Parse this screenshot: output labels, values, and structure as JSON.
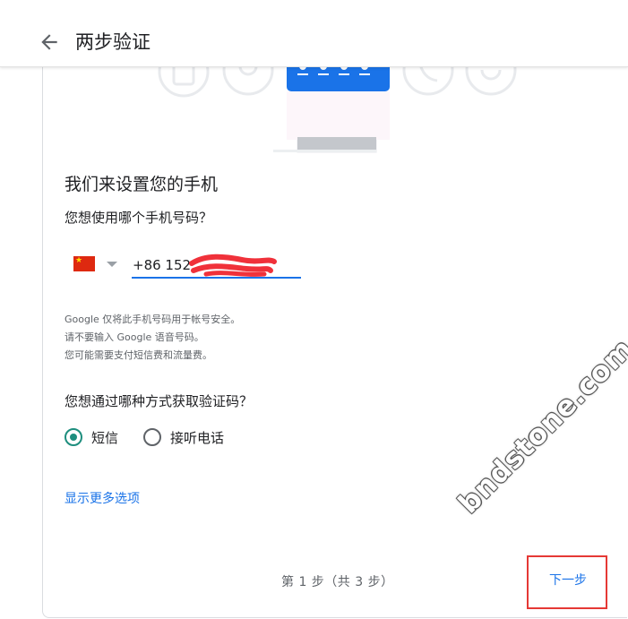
{
  "header": {
    "title": "两步验证",
    "back_icon": "arrow-back-icon"
  },
  "main": {
    "heading": "我们来设置您的手机",
    "phone_question": "您想使用哪个手机号码？",
    "country_flag": "china-flag-icon",
    "phone_value": "+86 152",
    "notes": [
      "Google 仅将此手机号码用于帐号安全。",
      "请不要输入 Google 语音号码。",
      "您可能需要支付短信费和流量费。"
    ],
    "method_question": "您想通过哪种方式获取验证码？",
    "options": [
      {
        "label": "短信",
        "checked": true
      },
      {
        "label": "接听电话",
        "checked": false
      }
    ],
    "more_options": "显示更多选项",
    "step_text": "第 1 步（共 3 步）",
    "next_label": "下一步"
  },
  "colors": {
    "accent": "#1a73e8",
    "radio_checked": "#1e8e7e",
    "highlight": "#e53935",
    "redaction": "#f0313a"
  },
  "watermark": "bndstone.com"
}
